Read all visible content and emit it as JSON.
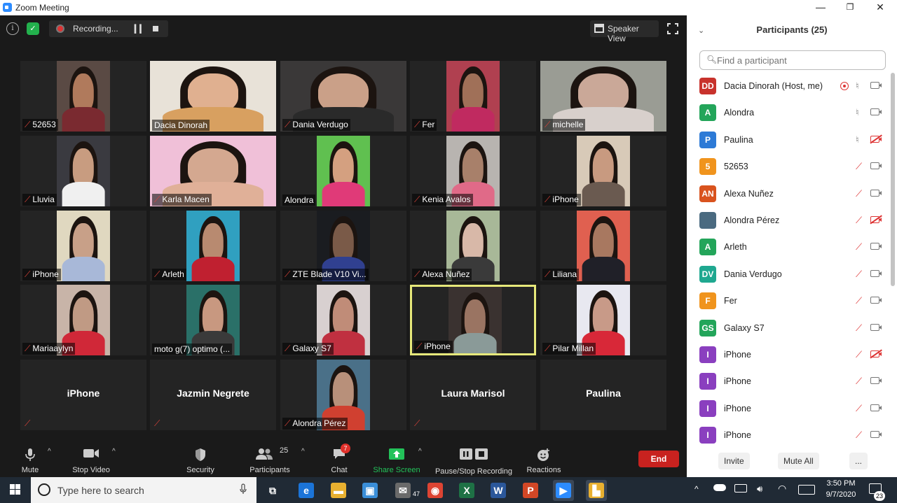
{
  "window": {
    "title": "Zoom Meeting",
    "minimize": "—",
    "restore": "❐",
    "close": "✕"
  },
  "top_bar": {
    "recording_label": "Recording...",
    "speaker_view_label": "Speaker View"
  },
  "tiles": [
    {
      "name": "52653",
      "muted": true,
      "video": true,
      "bg": "#5a4a44",
      "skin": "#b07a5c",
      "shirt": "#7a2a30",
      "wide": false
    },
    {
      "name": "Dacia Dinorah",
      "muted": false,
      "video": true,
      "bg": "#e8e2d8",
      "skin": "#e0b090",
      "shirt": "#d8a060",
      "wide": true
    },
    {
      "name": "Dania Verdugo",
      "muted": true,
      "video": true,
      "bg": "#3a3838",
      "skin": "#caa088",
      "shirt": "#2a2a2a",
      "wide": true
    },
    {
      "name": "Fer",
      "muted": true,
      "video": true,
      "bg": "#b04050",
      "skin": "#a07058",
      "shirt": "#c02a60",
      "wide": false
    },
    {
      "name": "michelle",
      "muted": true,
      "video": true,
      "bg": "#9a9c94",
      "skin": "#caa898",
      "shirt": "#d8d0cc",
      "wide": true
    },
    {
      "name": "Lluvia",
      "muted": true,
      "video": true,
      "bg": "#3a3a40",
      "skin": "#c89c80",
      "shirt": "#f0f0f0",
      "wide": false
    },
    {
      "name": "Karla Macen",
      "muted": true,
      "video": true,
      "bg": "#f0c0d8",
      "skin": "#d4a890",
      "shirt": "#e0b098",
      "wide": true
    },
    {
      "name": "Alondra",
      "muted": false,
      "video": true,
      "bg": "#60c050",
      "skin": "#d4a080",
      "shirt": "#e03a78",
      "wide": false
    },
    {
      "name": "Kenia Avalos",
      "muted": true,
      "video": true,
      "bg": "#b8b4b0",
      "skin": "#a8806a",
      "shirt": "#e06a88",
      "wide": false
    },
    {
      "name": "iPhone",
      "muted": true,
      "video": true,
      "bg": "#d8cab8",
      "skin": "#c89a80",
      "shirt": "#6a5a50",
      "wide": false
    },
    {
      "name": "iPhone",
      "muted": true,
      "video": true,
      "bg": "#e0d8c0",
      "skin": "#c8a088",
      "shirt": "#a8b8d8",
      "wide": false
    },
    {
      "name": "Arleth",
      "muted": true,
      "video": true,
      "bg": "#30a0c0",
      "skin": "#b88a70",
      "shirt": "#c02030",
      "wide": false
    },
    {
      "name": "ZTE Blade V10 Vi...",
      "muted": true,
      "video": true,
      "bg": "#1a1c20",
      "skin": "#7a5a48",
      "shirt": "#304090",
      "wide": false
    },
    {
      "name": "Alexa Nuñez",
      "muted": true,
      "video": true,
      "bg": "#a8b898",
      "skin": "#d8b8a8",
      "shirt": "#3a3a3a",
      "wide": false
    },
    {
      "name": "Liliana",
      "muted": true,
      "video": true,
      "bg": "#e06050",
      "skin": "#a87860",
      "shirt": "#202028",
      "wide": false
    },
    {
      "name": "Mariaaylyn",
      "muted": true,
      "video": true,
      "bg": "#c8b4a8",
      "skin": "#c09a84",
      "shirt": "#d02838",
      "wide": false
    },
    {
      "name": "moto g(7) optimo (...",
      "muted": false,
      "video": true,
      "bg": "#2a7068",
      "skin": "#c89880",
      "shirt": "#3a3a3a",
      "wide": false
    },
    {
      "name": "Galaxy S7",
      "muted": true,
      "video": true,
      "bg": "#d8d0d0",
      "skin": "#c08c78",
      "shirt": "#c03040",
      "wide": false
    },
    {
      "name": "iPhone",
      "muted": true,
      "video": true,
      "bg": "#3a3230",
      "skin": "#9a7462",
      "shirt": "#8a9a98",
      "wide": false
    },
    {
      "name": "Pilar Millan",
      "muted": true,
      "video": true,
      "bg": "#e8e8f0",
      "skin": "#c89a88",
      "shirt": "#d82838",
      "wide": false
    },
    {
      "name": "iPhone",
      "muted": true,
      "video": false
    },
    {
      "name": "Jazmin Negrete",
      "muted": true,
      "video": false
    },
    {
      "name": "Alondra Pérez",
      "muted": true,
      "video": true,
      "bg": "#4a7088",
      "skin": "#b8907a",
      "shirt": "#d04030",
      "wide": false
    },
    {
      "name": "Laura Marisol",
      "muted": true,
      "video": false
    },
    {
      "name": "Paulina",
      "muted": false,
      "video": false
    }
  ],
  "toolbar": {
    "mute_label": "Mute",
    "stop_video_label": "Stop Video",
    "security_label": "Security",
    "participants_label": "Participants",
    "participants_count": "25",
    "chat_label": "Chat",
    "chat_badge": "7",
    "share_screen_label": "Share Screen",
    "recording_label": "Pause/Stop Recording",
    "reactions_label": "Reactions",
    "end_label": "End"
  },
  "panel": {
    "title": "Participants (25)",
    "search_placeholder": "Find a participant",
    "participants": [
      {
        "initials": "DD",
        "name": "Dacia Dinorah (Host, me)",
        "color": "#c8322c",
        "recording": true,
        "mic": "on",
        "cam": "on"
      },
      {
        "initials": "A",
        "name": "Alondra",
        "color": "#23a55a",
        "recording": false,
        "mic": "on",
        "cam": "on"
      },
      {
        "initials": "P",
        "name": "Paulina",
        "color": "#2d7ad6",
        "recording": false,
        "mic": "on",
        "cam": "off"
      },
      {
        "initials": "5",
        "name": "52653",
        "color": "#f0941d",
        "recording": false,
        "mic": "off",
        "cam": "on"
      },
      {
        "initials": "AN",
        "name": "Alexa Nuñez",
        "color": "#d9531e",
        "recording": false,
        "mic": "off",
        "cam": "on"
      },
      {
        "initials": "",
        "name": "Alondra Pérez",
        "color": "#4a6a80",
        "recording": false,
        "mic": "off",
        "cam": "off"
      },
      {
        "initials": "A",
        "name": "Arleth",
        "color": "#23a55a",
        "recording": false,
        "mic": "off",
        "cam": "on"
      },
      {
        "initials": "DV",
        "name": "Dania Verdugo",
        "color": "#1fa890",
        "recording": false,
        "mic": "off",
        "cam": "on"
      },
      {
        "initials": "F",
        "name": "Fer",
        "color": "#f0941d",
        "recording": false,
        "mic": "off",
        "cam": "on"
      },
      {
        "initials": "GS",
        "name": "Galaxy S7",
        "color": "#23a55a",
        "recording": false,
        "mic": "off",
        "cam": "on"
      },
      {
        "initials": "I",
        "name": "iPhone",
        "color": "#8a3fbf",
        "recording": false,
        "mic": "off",
        "cam": "off"
      },
      {
        "initials": "I",
        "name": "iPhone",
        "color": "#8a3fbf",
        "recording": false,
        "mic": "off",
        "cam": "on"
      },
      {
        "initials": "I",
        "name": "iPhone",
        "color": "#8a3fbf",
        "recording": false,
        "mic": "off",
        "cam": "on"
      },
      {
        "initials": "I",
        "name": "iPhone",
        "color": "#8a3fbf",
        "recording": false,
        "mic": "off",
        "cam": "on"
      }
    ],
    "invite_label": "Invite",
    "mute_all_label": "Mute All",
    "more_label": "..."
  },
  "taskbar": {
    "search_text": "Type here to search",
    "mail_badge": "47",
    "time": "3:50 PM",
    "date": "9/7/2020",
    "notification_count": "23",
    "apps": [
      {
        "name": "task-view-icon",
        "glyph": "⧉",
        "color": "#202a35"
      },
      {
        "name": "edge-icon",
        "glyph": "e",
        "color": "#1b74d8"
      },
      {
        "name": "file-explorer-icon",
        "glyph": "▬",
        "color": "#e8b030"
      },
      {
        "name": "store-icon",
        "glyph": "▣",
        "color": "#3a8ed8"
      },
      {
        "name": "mail-icon",
        "glyph": "✉",
        "color": "#6a6a6a"
      },
      {
        "name": "chrome-icon",
        "glyph": "◉",
        "color": "#dd4433"
      },
      {
        "name": "excel-icon",
        "glyph": "X",
        "color": "#1e7145"
      },
      {
        "name": "word-icon",
        "glyph": "W",
        "color": "#2b579a"
      },
      {
        "name": "powerpoint-icon",
        "glyph": "P",
        "color": "#d24726"
      },
      {
        "name": "zoom-app-icon",
        "glyph": "▶",
        "color": "#2d8cff"
      },
      {
        "name": "folder-app-icon",
        "glyph": "▙",
        "color": "#e8b030"
      }
    ]
  }
}
